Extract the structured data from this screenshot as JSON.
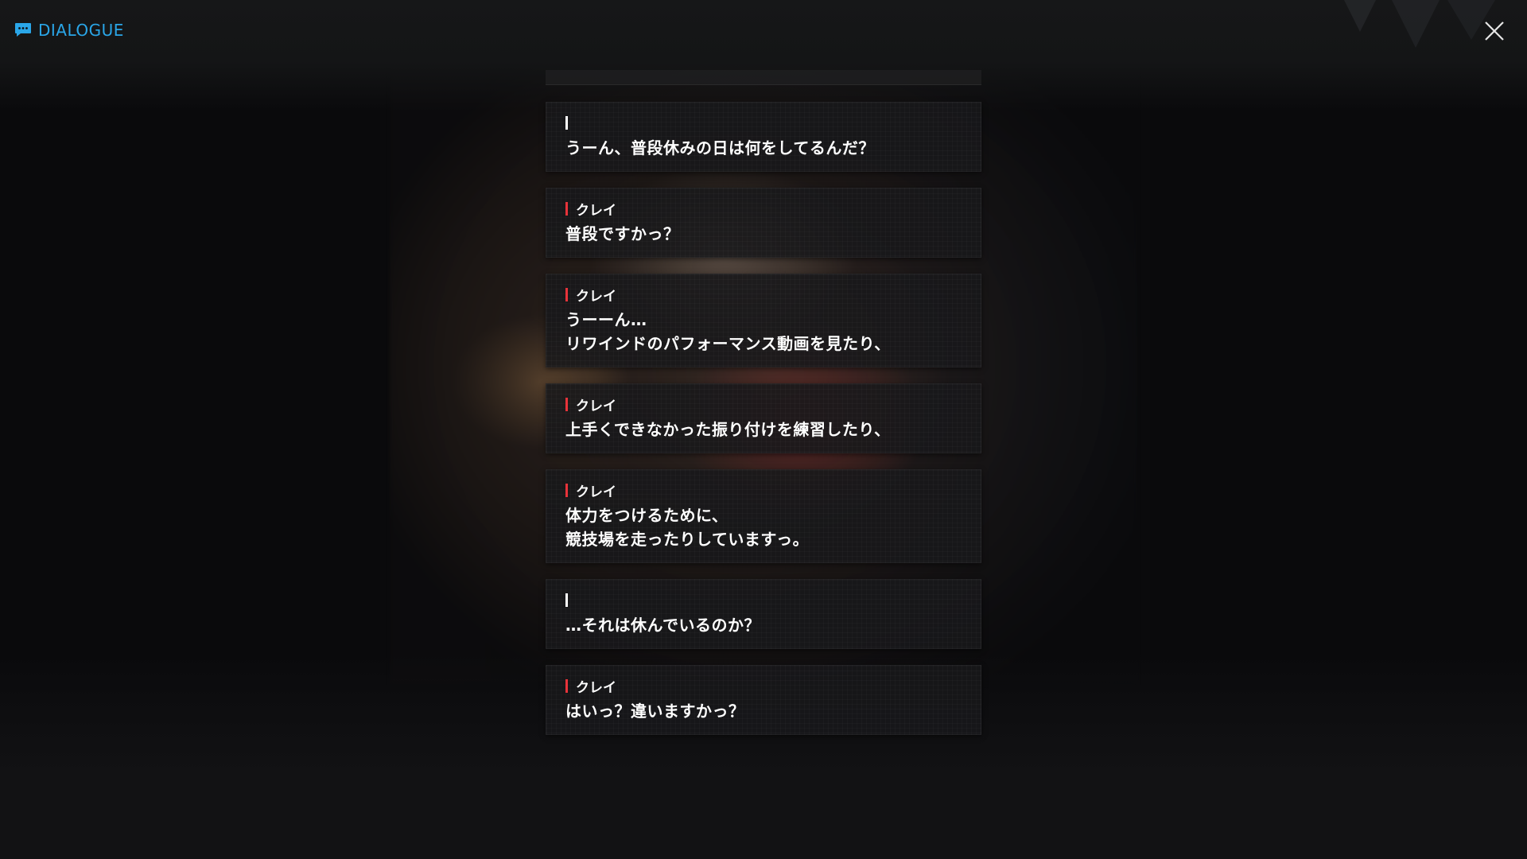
{
  "header": {
    "title": "DIALOGUE",
    "icon": "chat-bubble-icon",
    "accent_color": "#2aa6e8"
  },
  "close_icon": "close-icon",
  "speaker_color": "#e8333a",
  "entries": [
    {
      "speaker": "",
      "lines": [
        "うーん、普段休みの日は何をしてるんだ？"
      ]
    },
    {
      "speaker": "クレイ",
      "lines": [
        "普段ですかっ？"
      ]
    },
    {
      "speaker": "クレイ",
      "lines": [
        "うーーん…",
        "リワインドのパフォーマンス動画を見たり、"
      ]
    },
    {
      "speaker": "クレイ",
      "lines": [
        "上手くできなかった振り付けを練習したり、"
      ]
    },
    {
      "speaker": "クレイ",
      "lines": [
        "体力をつけるために、",
        "競技場を走ったりしていますっ。"
      ]
    },
    {
      "speaker": "",
      "lines": [
        "…それは休んでいるのか？"
      ]
    },
    {
      "speaker": "クレイ",
      "lines": [
        "はいっ？違いますかっ？"
      ]
    }
  ]
}
